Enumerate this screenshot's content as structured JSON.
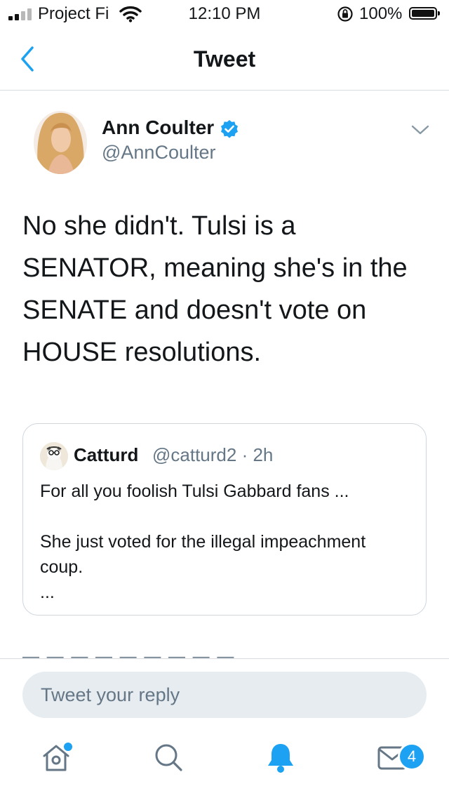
{
  "status_bar": {
    "carrier": "Project Fi",
    "time": "12:10 PM",
    "battery_percent": "100%"
  },
  "nav": {
    "title": "Tweet",
    "back_icon": "chevron-left-icon"
  },
  "tweet": {
    "author_name": "Ann Coulter",
    "author_handle": "@AnnCoulter",
    "verified": true,
    "text": "No she didn't.  Tulsi is a SENATOR, meaning she's in the SENATE and doesn't vote on HOUSE resolutions."
  },
  "quoted_tweet": {
    "author_name": "Catturd",
    "author_handle": "@catturd2",
    "age": "2h",
    "text": "For all you foolish Tulsi Gabbard fans ...\n\nShe just voted for the illegal impeachment coup.\n..."
  },
  "reply": {
    "placeholder": "Tweet your reply"
  },
  "tabbar": {
    "messages_badge": "4"
  },
  "colors": {
    "accent": "#1da1f2",
    "text_primary": "#14171a",
    "text_secondary": "#657786",
    "reply_bg": "#e6ecf0"
  }
}
